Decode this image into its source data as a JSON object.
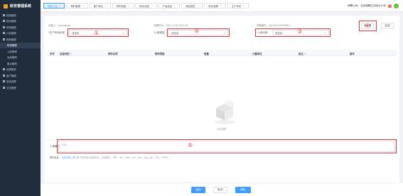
{
  "app": {
    "name": "财务管理系统"
  },
  "sidebar": {
    "items": [
      {
        "label": "档案管理",
        "sub": false,
        "active": false
      },
      {
        "label": "财务管理",
        "sub": false,
        "active": false
      },
      {
        "label": "采购管理",
        "sub": false,
        "active": false
      },
      {
        "label": "计划管理",
        "sub": false,
        "active": false
      },
      {
        "label": "物资管理",
        "sub": false,
        "active": false
      },
      {
        "label": "物资管理",
        "sub": true,
        "active": true
      },
      {
        "label": "入库管理",
        "sub": true,
        "active": false
      },
      {
        "label": "出库管理",
        "sub": true,
        "active": false
      },
      {
        "label": "盘点管理",
        "sub": true,
        "active": false
      },
      {
        "label": "资源报表",
        "sub": false,
        "active": false
      },
      {
        "label": "客户管理",
        "sub": false,
        "active": false
      },
      {
        "label": "系统设置",
        "sub": false,
        "active": false
      },
      {
        "label": "日志管理",
        "sub": false,
        "active": false
      }
    ]
  },
  "topbar": {
    "tabs": [
      {
        "label": "物资入库",
        "active": true
      },
      {
        "label": "物料管理",
        "active": false
      },
      {
        "label": "客户单位",
        "active": false
      },
      {
        "label": "物料档案",
        "active": false
      },
      {
        "label": "库存台账",
        "active": false
      },
      {
        "label": "产品信息",
        "active": false
      },
      {
        "label": "商品类型",
        "active": false
      },
      {
        "label": "库存管理",
        "active": false
      },
      {
        "label": "生产车间",
        "active": false
      }
    ],
    "company": "研腾公司：北京瑞腾立创设计公司",
    "close_char": "×"
  },
  "form": {
    "creator": "创建人：zaqzhanran",
    "create_time": "创建时间：2024-11-25 15:57:26",
    "doc_no": "单据编号：LB20241125000001",
    "field1_label": "*生产车间名称",
    "field2_label": "*入库类型",
    "field3_label": "*入库仓库",
    "select_placeholder": "请选择",
    "btn_settings": "列设置",
    "btn_back": "返回",
    "annotations": [
      "①",
      "②",
      "③",
      "④",
      "⑤"
    ]
  },
  "table": {
    "headers": [
      "序号",
      "设备类别",
      "物料名称",
      "物料规格",
      "数量",
      "计量单位",
      "备注",
      "操作"
    ],
    "edit_mark": "✎",
    "empty_text": "暂无数据"
  },
  "remark": {
    "label": "入库备注",
    "placeholder": "请输入"
  },
  "attachment": {
    "label": "附件信息：",
    "link": "点击此处上传",
    "hint": "(单个附件最大支持50M，支持格式：PDF、doc、docx、xls、xlsx、png、jpg、JPG、JPEG)"
  },
  "footer": {
    "save": "保存",
    "cancel": "取消",
    "submit": "确定"
  },
  "colors": {
    "sidebar_bg": "#1f2d3d",
    "primary": "#409eff",
    "annotation": "#e0393e"
  }
}
